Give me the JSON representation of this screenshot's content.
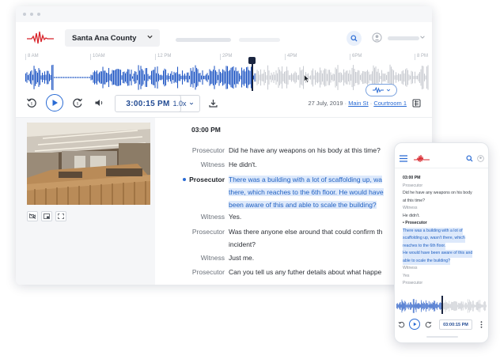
{
  "header": {
    "county": "Santa Ana County"
  },
  "timeline": {
    "ticks": [
      "8 AM",
      "10AM",
      "12 PM",
      "2PM",
      "4PM",
      "6PM",
      "8 PM"
    ],
    "progress": 0.57
  },
  "controls": {
    "time": "3:00:15 PM",
    "speed": "1.0x",
    "date": "27 July, 2019",
    "separator": "·",
    "location": "Main St",
    "room": "Courtroom 1"
  },
  "transcript": {
    "timestamp": "03:00 PM",
    "lines": [
      {
        "speaker": "Prosecutor",
        "text": "Did he have any weapons on his body at this time?"
      },
      {
        "speaker": "Witness",
        "text": "He didn't."
      },
      {
        "speaker": "Prosecutor",
        "text": "There was a building with a lot of scaffolding up, wa",
        "text2": "there, which reaches to the 6th floor. He would have",
        "text3": "been aware of this and able to scale the building?"
      },
      {
        "speaker": "Witness",
        "text": "Yes."
      },
      {
        "speaker": "Prosecutor",
        "text": "Was there anyone else around that could confirm th",
        "text2": "incident?"
      },
      {
        "speaker": "Witness",
        "text": "Just me."
      },
      {
        "speaker": "Prosecutor",
        "text": "Can you tell us any futher details about what happe"
      }
    ]
  },
  "phone": {
    "timestamp": "03:00 PM",
    "line1_speaker": "Prosecutor",
    "line1_text_a": "Did he have any weapons on his body",
    "line1_text_b": "at this time?",
    "line2_speaker": "Witness",
    "line2_text": "He didn't.",
    "line3_speaker": "Prosecutor",
    "line3_a": "There was a building with a lot of",
    "line3_b": "scaffolding up, wasn't there, which",
    "line3_c": "reaches to the 6th floor.",
    "line3_d": "He would have been aware of this and",
    "line3_e": "able to scale the building?",
    "line4_speaker": "Witness",
    "line4_text": "Yes",
    "line5_speaker": "Prosecutor",
    "time": "03:00:15 PM"
  },
  "colors": {
    "accent": "#2a6bd4",
    "brand_red": "#d8232a",
    "wave_played": "#1f56c4",
    "wave_unplayed": "#c9ccd2",
    "highlight_bg": "#dde9fb"
  }
}
